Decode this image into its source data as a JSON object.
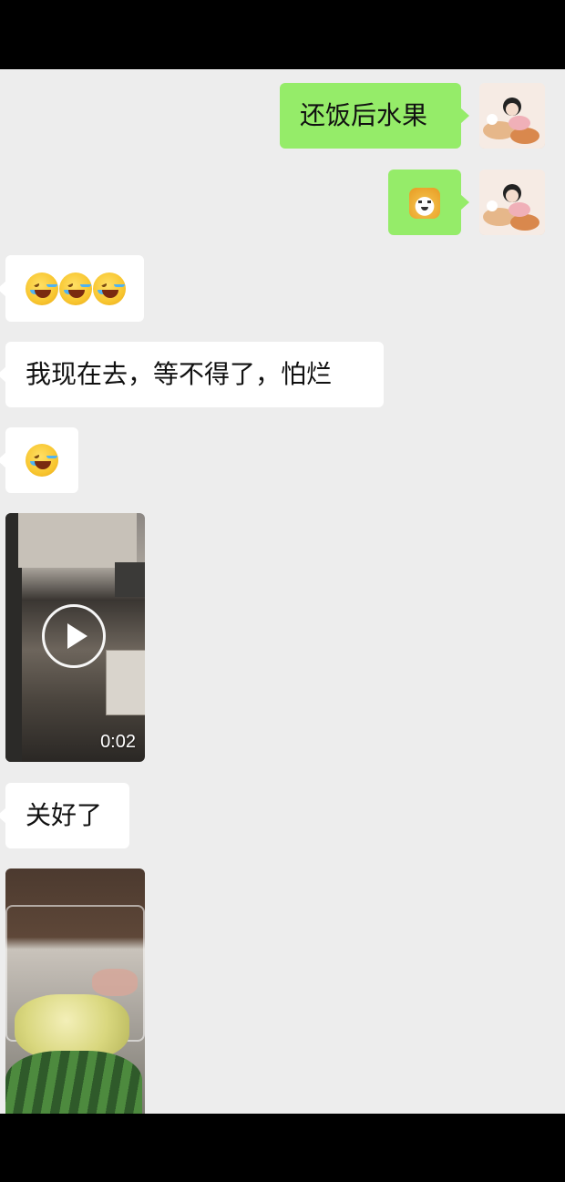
{
  "messages": [
    {
      "side": "right",
      "type": "text",
      "text": "还饭后水果"
    },
    {
      "side": "right",
      "type": "sticker",
      "icon": "doge-emoji"
    },
    {
      "side": "left",
      "type": "emoji",
      "icon": "laughing-crying-emoji",
      "count": 3
    },
    {
      "side": "left",
      "type": "text",
      "text": "我现在去，等不得了，怕烂"
    },
    {
      "side": "left",
      "type": "emoji",
      "icon": "laughing-crying-emoji",
      "count": 1
    },
    {
      "side": "left",
      "type": "video",
      "duration": "0:02"
    },
    {
      "side": "left",
      "type": "text",
      "text": "关好了"
    },
    {
      "side": "left",
      "type": "image"
    }
  ],
  "colors": {
    "background": "#ededed",
    "sent_bubble": "#95ec69",
    "received_bubble": "#ffffff"
  }
}
